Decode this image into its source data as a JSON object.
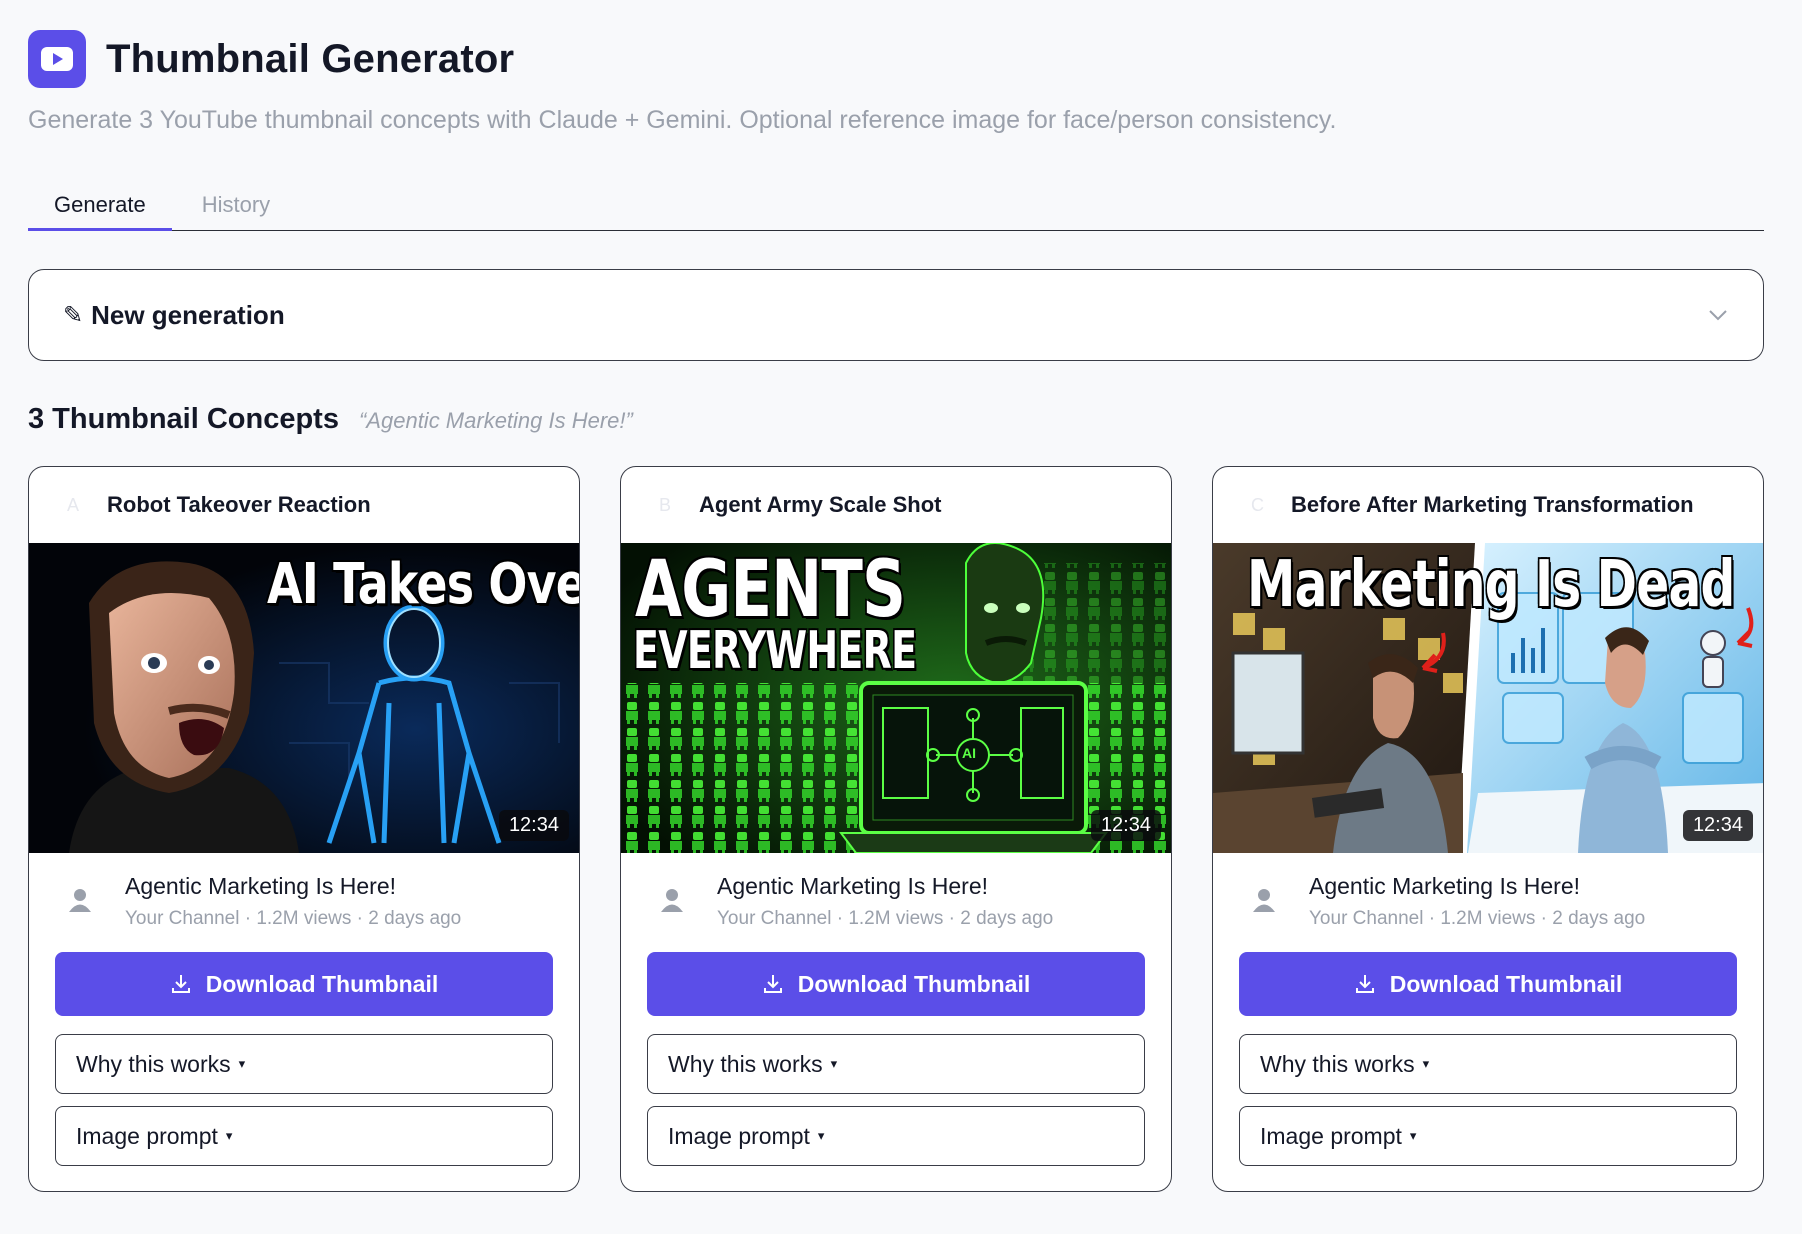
{
  "app": {
    "title": "Thumbnail Generator",
    "subtitle": "Generate 3 YouTube thumbnail concepts with Claude + Gemini. Optional reference image for face/person consistency.",
    "logo_icon": "play-icon",
    "accent": "#5b4ee8"
  },
  "tabs": [
    {
      "label": "Generate",
      "active": true
    },
    {
      "label": "History",
      "active": false
    }
  ],
  "new_generation": {
    "label": "New generation",
    "icon": "pencil-icon",
    "toggle_icon": "chevron-down-icon"
  },
  "concepts": {
    "heading": "3 Thumbnail Concepts",
    "video_title_quote": "“Agentic Marketing Is Here!”"
  },
  "cards": [
    {
      "letter": "A",
      "concept_title": "Robot Takeover Reaction",
      "thumb_text_1": "AI Takes Over",
      "duration": "12:34",
      "video_title": "Agentic Marketing Is Here!",
      "meta": "Your Channel · 1.2M views · 2 days ago",
      "download_label": "Download Thumbnail",
      "why_label": "Why this works",
      "prompt_label": "Image prompt",
      "caret": "▾"
    },
    {
      "letter": "B",
      "concept_title": "Agent Army Scale Shot",
      "thumb_text_1": "AGENTS",
      "thumb_text_2": "EVERYWHERE",
      "thumb_screen_label": "AI",
      "duration": "12:34",
      "video_title": "Agentic Marketing Is Here!",
      "meta": "Your Channel · 1.2M views · 2 days ago",
      "download_label": "Download Thumbnail",
      "why_label": "Why this works",
      "prompt_label": "Image prompt",
      "caret": "▾"
    },
    {
      "letter": "C",
      "concept_title": "Before After Marketing Transformation",
      "thumb_text_1": "Marketing Is Dead",
      "duration": "12:34",
      "video_title": "Agentic Marketing Is Here!",
      "meta": "Your Channel · 1.2M views · 2 days ago",
      "download_label": "Download Thumbnail",
      "why_label": "Why this works",
      "prompt_label": "Image prompt",
      "caret": "▾"
    }
  ]
}
